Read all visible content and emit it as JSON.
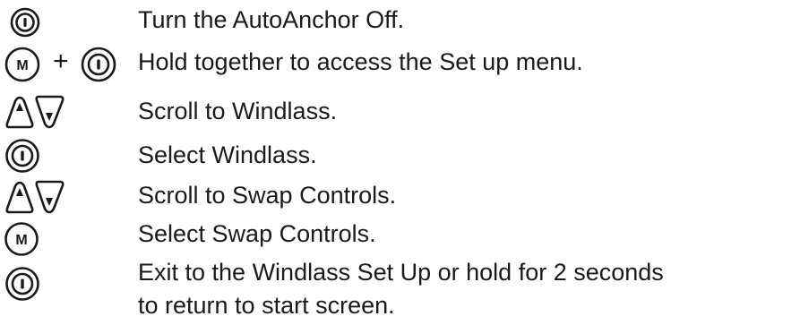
{
  "steps": [
    {
      "icons": [
        "power-button-icon"
      ],
      "text": "Turn the AutoAnchor Off."
    },
    {
      "icons": [
        "mode-button-icon",
        "plus-sign",
        "power-button-icon"
      ],
      "plus": "+",
      "text": "Hold together to access the Set up menu."
    },
    {
      "icons": [
        "up-arrow-button-icon",
        "down-arrow-button-icon"
      ],
      "text": "Scroll to Windlass."
    },
    {
      "icons": [
        "power-button-icon"
      ],
      "text": "Select Windlass."
    },
    {
      "icons": [
        "up-arrow-button-icon",
        "down-arrow-button-icon"
      ],
      "text": "Scroll to Swap Controls."
    },
    {
      "icons": [
        "mode-button-icon"
      ],
      "text": "Select Swap Controls."
    },
    {
      "icons": [
        "power-button-icon"
      ],
      "text_line1": "Exit to the Windlass Set Up or hold for 2 seconds",
      "text_line2": "to return to start screen."
    }
  ],
  "icon_glyphs": {
    "mode_letter": "M"
  }
}
